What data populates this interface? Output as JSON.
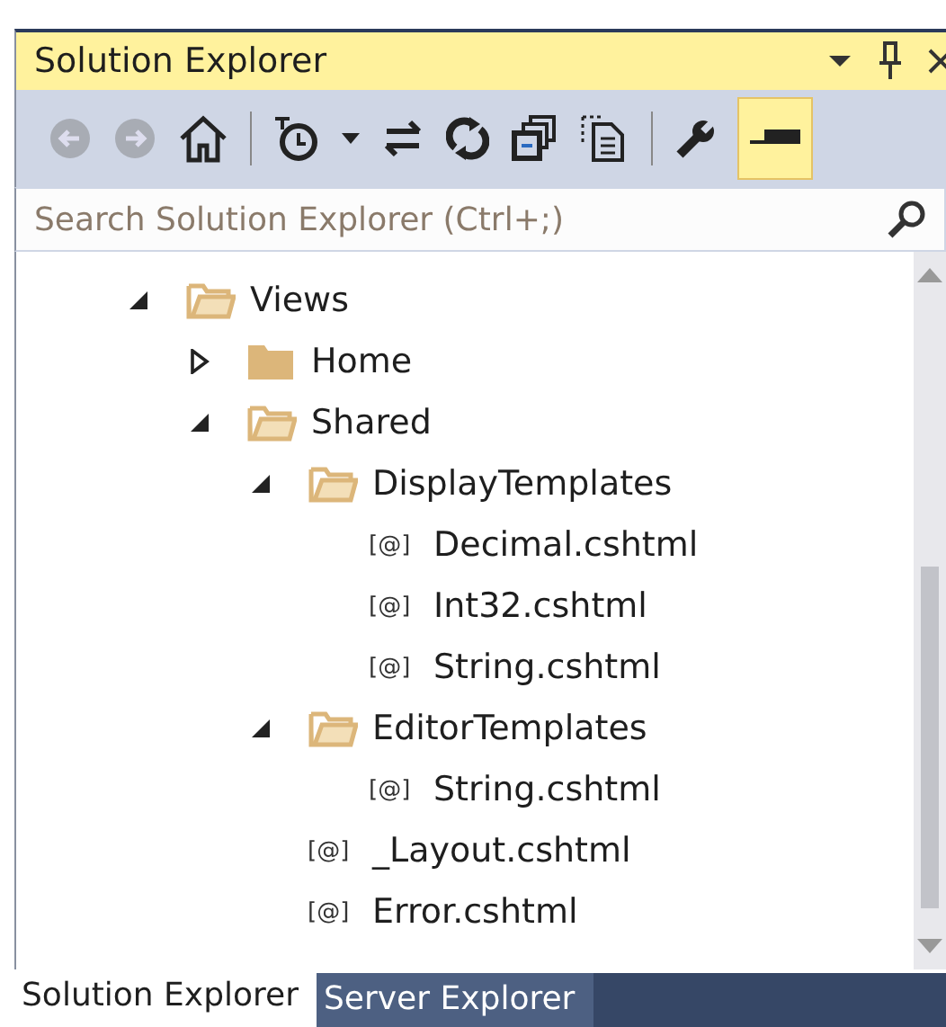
{
  "window": {
    "title": "Solution Explorer"
  },
  "search": {
    "placeholder": "Search Solution Explorer (Ctrl+;)"
  },
  "toolbar": {
    "sync_active": true
  },
  "tree": [
    {
      "kind": "folder",
      "label": "Views",
      "expanded": true,
      "children": [
        {
          "kind": "folder",
          "label": "Home",
          "expanded": false
        },
        {
          "kind": "folder",
          "label": "Shared",
          "expanded": true,
          "children": [
            {
              "kind": "folder",
              "label": "DisplayTemplates",
              "expanded": true,
              "children": [
                {
                  "kind": "file",
                  "icon_text": "[@]",
                  "label": "Decimal.cshtml"
                },
                {
                  "kind": "file",
                  "icon_text": "[@]",
                  "label": "Int32.cshtml"
                },
                {
                  "kind": "file",
                  "icon_text": "[@]",
                  "label": "String.cshtml"
                }
              ]
            },
            {
              "kind": "folder",
              "label": "EditorTemplates",
              "expanded": true,
              "children": [
                {
                  "kind": "file",
                  "icon_text": "[@]",
                  "label": "String.cshtml"
                }
              ]
            },
            {
              "kind": "file",
              "icon_text": "[@]",
              "label": "_Layout.cshtml"
            },
            {
              "kind": "file",
              "icon_text": "[@]",
              "label": "Error.cshtml"
            }
          ]
        }
      ]
    }
  ],
  "bottom_tabs": [
    {
      "label": "Solution Explorer",
      "selected": true
    },
    {
      "label": "Server Explorer",
      "selected": false
    }
  ]
}
